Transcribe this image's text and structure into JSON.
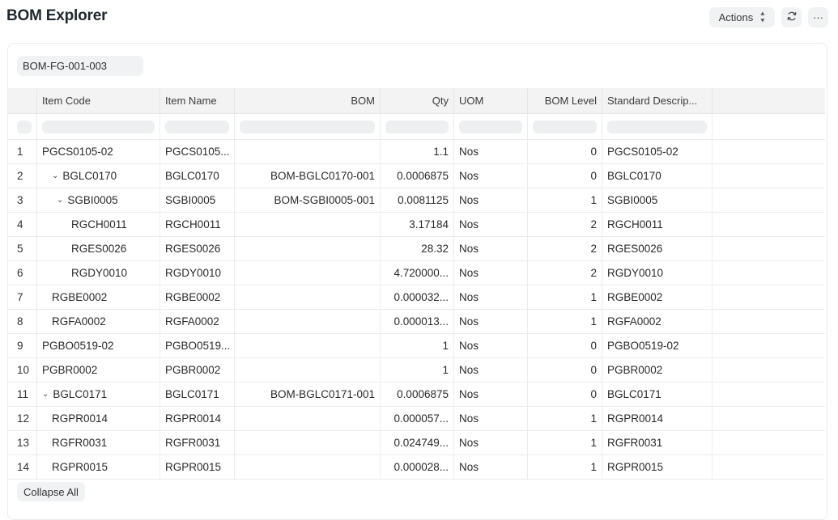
{
  "page": {
    "title": "BOM Explorer"
  },
  "header_actions": {
    "actions_label": "Actions",
    "refresh_icon": "refresh-icon",
    "more_label": "···"
  },
  "filter": {
    "bom_value": "BOM-FG-001-003"
  },
  "table": {
    "columns": [
      "Item Code",
      "Item Name",
      "BOM",
      "Qty",
      "UOM",
      "BOM Level",
      "Standard Descrip..."
    ],
    "rows": [
      {
        "num": "1",
        "code": "PGCS0105-02",
        "name": "PGCS0105...",
        "bom": "",
        "qty": "1.1",
        "uom": "Nos",
        "level": "0",
        "desc": "PGCS0105-02"
      },
      {
        "num": "2",
        "code": "BGLC0170",
        "name": "BGLC0170",
        "bom": "BOM-BGLC0170-001",
        "qty": "0.0006875",
        "uom": "Nos",
        "level": "0",
        "desc": "BGLC0170"
      },
      {
        "num": "3",
        "code": "SGBI0005",
        "name": "SGBI0005",
        "bom": "BOM-SGBI0005-001",
        "qty": "0.0081125",
        "uom": "Nos",
        "level": "1",
        "desc": "SGBI0005"
      },
      {
        "num": "4",
        "code": "RGCH0011",
        "name": "RGCH0011",
        "bom": "",
        "qty": "3.17184",
        "uom": "Nos",
        "level": "2",
        "desc": "RGCH0011"
      },
      {
        "num": "5",
        "code": "RGES0026",
        "name": "RGES0026",
        "bom": "",
        "qty": "28.32",
        "uom": "Nos",
        "level": "2",
        "desc": "RGES0026"
      },
      {
        "num": "6",
        "code": "RGDY0010",
        "name": "RGDY0010",
        "bom": "",
        "qty": "4.720000...",
        "uom": "Nos",
        "level": "2",
        "desc": "RGDY0010"
      },
      {
        "num": "7",
        "code": "RGBE0002",
        "name": "RGBE0002",
        "bom": "",
        "qty": "0.000032...",
        "uom": "Nos",
        "level": "1",
        "desc": "RGBE0002"
      },
      {
        "num": "8",
        "code": "RGFA0002",
        "name": "RGFA0002",
        "bom": "",
        "qty": "0.000013...",
        "uom": "Nos",
        "level": "1",
        "desc": "RGFA0002"
      },
      {
        "num": "9",
        "code": "PGBO0519-02",
        "name": "PGBO0519...",
        "bom": "",
        "qty": "1",
        "uom": "Nos",
        "level": "0",
        "desc": "PGBO0519-02"
      },
      {
        "num": "10",
        "code": "PGBR0002",
        "name": "PGBR0002",
        "bom": "",
        "qty": "1",
        "uom": "Nos",
        "level": "0",
        "desc": "PGBR0002"
      },
      {
        "num": "11",
        "code": "BGLC0171",
        "name": "BGLC0171",
        "bom": "BOM-BGLC0171-001",
        "qty": "0.0006875",
        "uom": "Nos",
        "level": "0",
        "desc": "BGLC0171"
      },
      {
        "num": "12",
        "code": "RGPR0014",
        "name": "RGPR0014",
        "bom": "",
        "qty": "0.000057...",
        "uom": "Nos",
        "level": "1",
        "desc": "RGPR0014"
      },
      {
        "num": "13",
        "code": "RGFR0031",
        "name": "RGFR0031",
        "bom": "",
        "qty": "0.024749...",
        "uom": "Nos",
        "level": "1",
        "desc": "RGFR0031"
      },
      {
        "num": "14",
        "code": "RGPR0015",
        "name": "RGPR0015",
        "bom": "",
        "qty": "0.000028...",
        "uom": "Nos",
        "level": "1",
        "desc": "RGPR0015"
      }
    ]
  },
  "footer": {
    "collapse_label": "Collapse All"
  }
}
